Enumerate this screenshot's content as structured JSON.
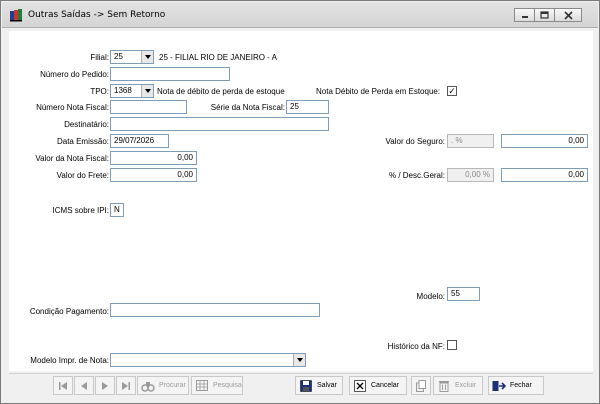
{
  "window": {
    "title": "Outras Saídas -> Sem Retorno"
  },
  "form": {
    "filial": {
      "label": "Filial:",
      "value": "25",
      "description": "25 - FILIAL RIO DE JANEIRO - A"
    },
    "numero_pedido": {
      "label": "Número do Pedido:",
      "value": ""
    },
    "tpo": {
      "label": "TPO:",
      "value": "1368",
      "description": "Nota de débito de perda de estoque"
    },
    "nota_debito": {
      "label": "Nota Débito de Perda em Estoque:",
      "checked": true,
      "mark": "✓"
    },
    "numero_nota_fiscal": {
      "label": "Número Nota Fiscal:",
      "value": ""
    },
    "serie_nota_fiscal": {
      "label": "Série da Nota Fiscal:",
      "value": "25"
    },
    "destinatario": {
      "label": "Destinatário:",
      "value": ""
    },
    "data_emissao": {
      "label": "Data Emissão:",
      "value": "29/07/2026"
    },
    "valor_seguro": {
      "label": "Valor do Seguro:",
      "percent": " .  %",
      "value": "0,00"
    },
    "valor_nota_fiscal": {
      "label": "Valor da Nota Fiscal:",
      "value": "0,00"
    },
    "valor_frete": {
      "label": "Valor do Frete:",
      "value": "0,00"
    },
    "desc_geral": {
      "label": "% / Desc.Geral:",
      "percent": "0,00 %",
      "value": "0,00"
    },
    "icms_ipi": {
      "label": "ICMS sobre IPI:",
      "value": "N"
    },
    "modelo": {
      "label": "Modelo:",
      "value": "55"
    },
    "condicao_pagamento": {
      "label": "Condição Pagamento:",
      "value": ""
    },
    "historico_nf": {
      "label": "Histórico da NF:",
      "checked": false
    },
    "modelo_impr": {
      "label": "Modelo Impr. de Nota:",
      "value": ""
    }
  },
  "toolbar": {
    "procurar": "Procurar",
    "pesquisa": "Pesquisa",
    "salvar": "Salvar",
    "cancelar": "Cancelar",
    "excluir": "Excluir",
    "fechar": "Fechar"
  }
}
